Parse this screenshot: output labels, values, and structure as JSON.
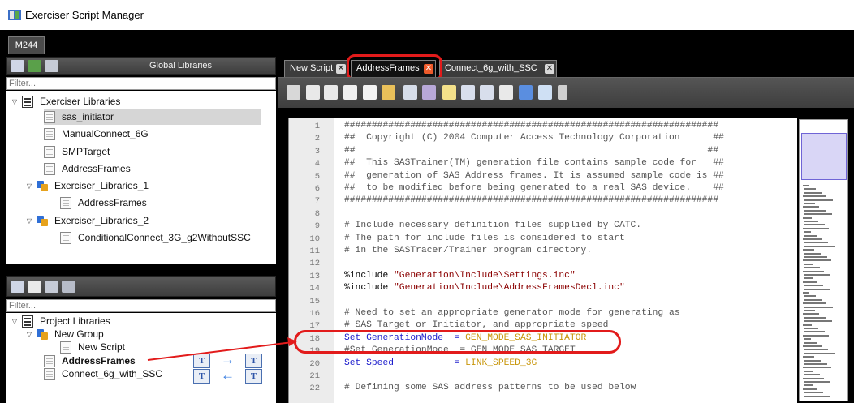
{
  "window": {
    "title": "Exerciser Script Manager"
  },
  "device_tab": "M244",
  "global_libraries": {
    "header": "Global Libraries",
    "filter_placeholder": "Filter...",
    "tree": [
      {
        "label": "Exerciser Libraries",
        "type": "list",
        "expanded": true
      },
      {
        "label": "sas_initiator",
        "type": "file",
        "selected": true
      },
      {
        "label": "ManualConnect_6G",
        "type": "file"
      },
      {
        "label": "SMPTarget",
        "type": "file"
      },
      {
        "label": "AddressFrames",
        "type": "file"
      },
      {
        "label": "Exerciser_Libraries_1",
        "type": "group",
        "expanded": true
      },
      {
        "label": "AddressFrames",
        "type": "file"
      },
      {
        "label": "Exerciser_Libraries_2",
        "type": "group",
        "expanded": true
      },
      {
        "label": "ConditionalConnect_3G_g2WithoutSSC",
        "type": "file"
      }
    ]
  },
  "project_libraries": {
    "filter_placeholder": "Filter...",
    "tree": [
      {
        "label": "Project Libraries",
        "type": "list",
        "expanded": true
      },
      {
        "label": "New Group",
        "type": "group",
        "expanded": true
      },
      {
        "label": "New Script",
        "type": "file"
      },
      {
        "label": "AddressFrames",
        "type": "file",
        "bold": true
      },
      {
        "label": "Connect_6g_with_SSC",
        "type": "file"
      }
    ],
    "transfer_glyph": "T"
  },
  "editor_tabs": [
    {
      "label": "New Script",
      "active": false
    },
    {
      "label": "AddressFrames",
      "active": true
    },
    {
      "label": "Connect_6g_with_SSC",
      "active": false
    }
  ],
  "code_lines": [
    {
      "n": "1",
      "text": "####################################################################"
    },
    {
      "n": "2",
      "text": "##  Copyright (C) 2004 Computer Access Technology Corporation      ##"
    },
    {
      "n": "3",
      "text": "##                                                                ##"
    },
    {
      "n": "4",
      "text": "##  This SASTrainer(TM) generation file contains sample code for   ##"
    },
    {
      "n": "5",
      "text": "##  generation of SAS Address frames. It is assumed sample code is ##"
    },
    {
      "n": "6",
      "text": "##  to be modified before being generated to a real SAS device.    ##"
    },
    {
      "n": "7",
      "text": "####################################################################"
    },
    {
      "n": "8",
      "text": ""
    },
    {
      "n": "9",
      "text": "# Include necessary definition files supplied by CATC."
    },
    {
      "n": "10",
      "text": "# The path for include files is considered to start"
    },
    {
      "n": "11",
      "text": "# in the SASTracer/Trainer program directory."
    },
    {
      "n": "12",
      "text": ""
    },
    {
      "n": "13",
      "kw": "%include",
      "str": " \"Generation\\Include\\Settings.inc\""
    },
    {
      "n": "14",
      "kw": "%include",
      "str": " \"Generation\\Include\\AddressFramesDecl.inc\""
    },
    {
      "n": "15",
      "text": ""
    },
    {
      "n": "16",
      "text": "# Need to set an appropriate generator mode for generating as"
    },
    {
      "n": "17",
      "text": "# SAS Target or Initiator, and appropriate speed"
    },
    {
      "n": "18",
      "kw": "Set GenerationMode",
      "op": "  = ",
      "const": "GEN_MODE_SAS_INITIATOR"
    },
    {
      "n": "19",
      "text": "#Set GenerationMode  = GEN_MODE_SAS_TARGET"
    },
    {
      "n": "20",
      "kw": "Set Speed",
      "op": "           = ",
      "const": "LINK_SPEED_3G"
    },
    {
      "n": "21",
      "text": ""
    },
    {
      "n": "22",
      "text": "# Defining some SAS address patterns to be used below"
    }
  ],
  "colors": {
    "callout": "#e21b1b",
    "keyword": "#1d1dcc",
    "string": "#8b0000",
    "constant": "#c8960a"
  }
}
